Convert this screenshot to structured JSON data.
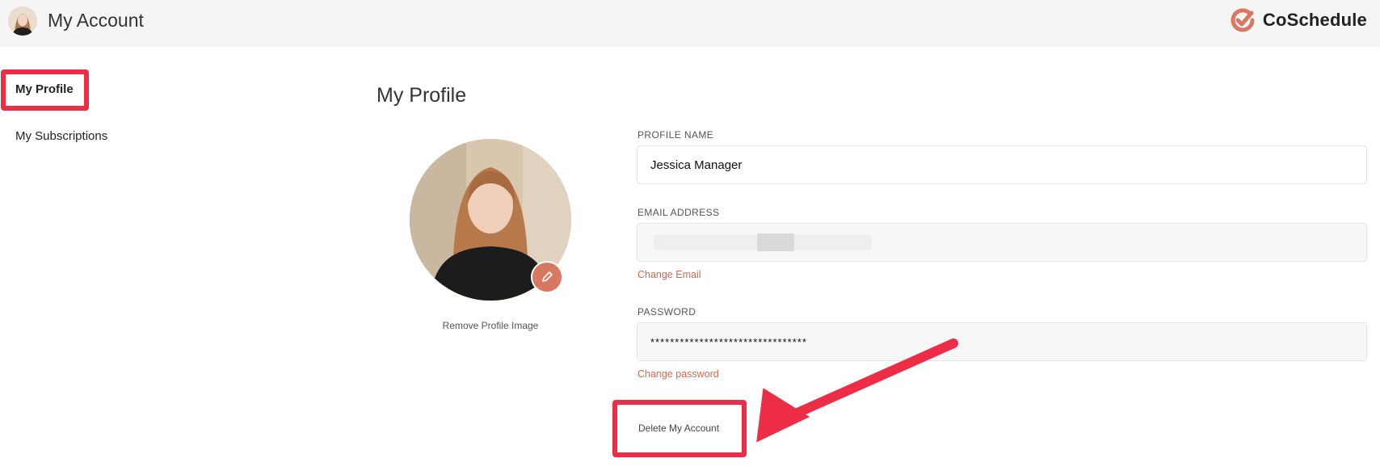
{
  "header": {
    "title": "My Account",
    "brand_name": "CoSchedule",
    "brand_color": "#d97861"
  },
  "sidebar": {
    "items": [
      {
        "label": "My Profile",
        "active": true
      },
      {
        "label": "My Subscriptions",
        "active": false
      }
    ]
  },
  "main": {
    "section_title": "My Profile",
    "remove_image_label": "Remove Profile Image",
    "fields": {
      "name": {
        "label": "PROFILE NAME",
        "value": "Jessica Manager"
      },
      "email": {
        "label": "EMAIL ADDRESS",
        "value": "",
        "link": "Change Email"
      },
      "password": {
        "label": "PASSWORD",
        "value": "********************************",
        "link": "Change password"
      }
    },
    "delete_label": "Delete My Account"
  },
  "annotation": {
    "color": "#ec2d45"
  },
  "icons": {
    "avatar": "user-avatar",
    "brand": "coschedule-logo-icon",
    "edit": "pencil-icon"
  }
}
